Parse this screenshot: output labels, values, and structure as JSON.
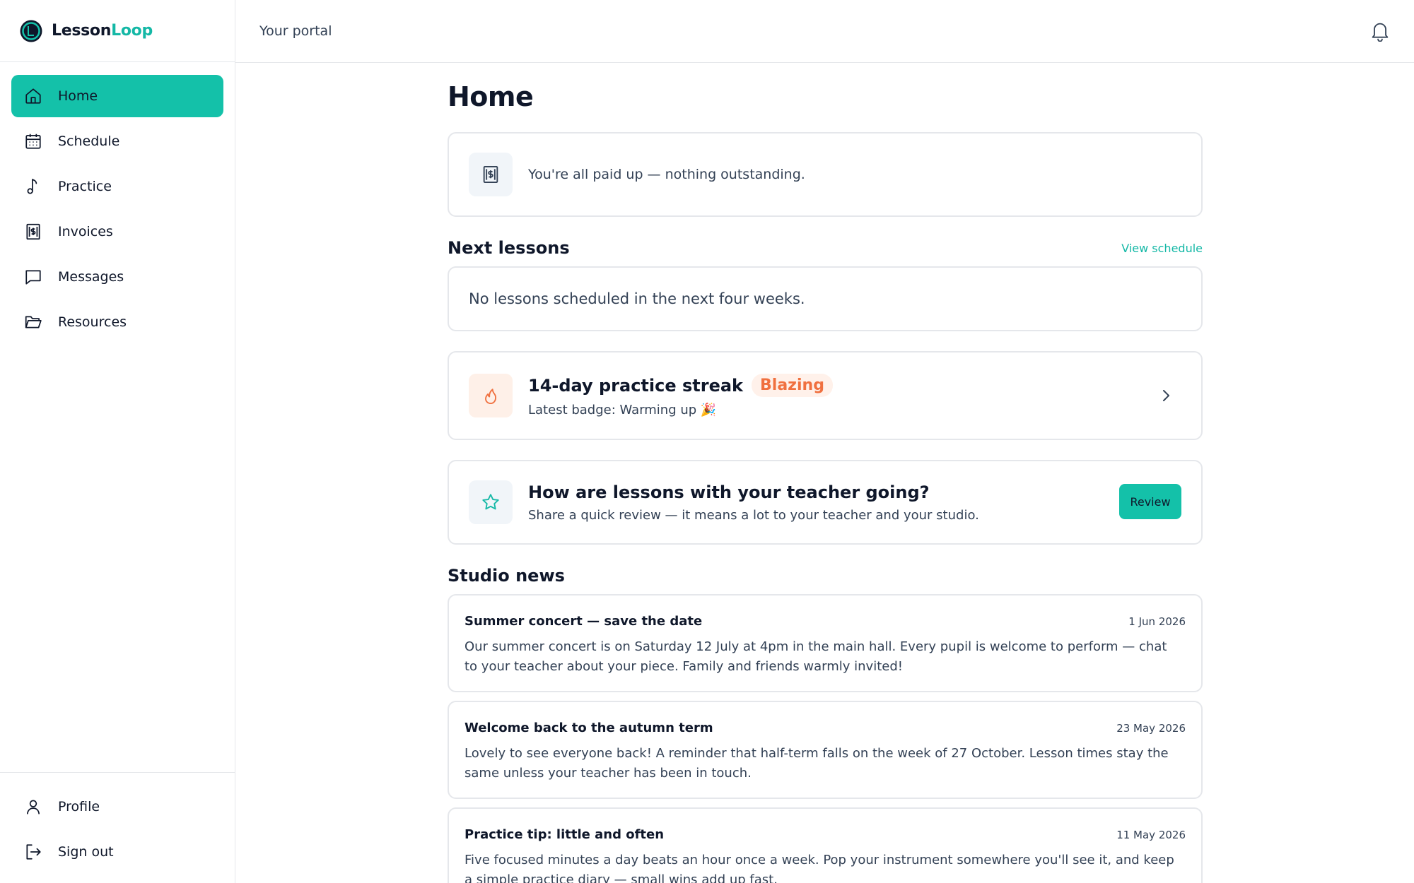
{
  "brand": {
    "name_part1": "Lesson",
    "name_part2": "Loop",
    "accent": "#14c1a9"
  },
  "sidebar": {
    "items": [
      {
        "label": "Home",
        "icon": "home-icon",
        "active": true
      },
      {
        "label": "Schedule",
        "icon": "calendar-icon",
        "active": false
      },
      {
        "label": "Practice",
        "icon": "music-note-icon",
        "active": false
      },
      {
        "label": "Invoices",
        "icon": "invoice-icon",
        "active": false
      },
      {
        "label": "Messages",
        "icon": "message-icon",
        "active": false
      },
      {
        "label": "Resources",
        "icon": "folder-icon",
        "active": false
      }
    ],
    "bottom_items": [
      {
        "label": "Profile",
        "icon": "user-icon"
      },
      {
        "label": "Sign out",
        "icon": "sign-out-icon"
      }
    ]
  },
  "topbar": {
    "title": "Your portal",
    "notifications_icon": "bell-icon"
  },
  "main": {
    "title": "Home",
    "payment_status": "You're all paid up — nothing outstanding.",
    "next_lessons": {
      "title": "Next lessons",
      "link": "View schedule",
      "empty_text": "No lessons scheduled in the next four weeks."
    },
    "streak": {
      "title": "14-day practice streak",
      "badge": "Blazing",
      "subtitle": "Latest badge: Warming up 🎉"
    },
    "review": {
      "title": "How are lessons with your teacher going?",
      "subtitle": "Share a quick review — it means a lot to your teacher and your studio.",
      "button": "Review"
    },
    "news": {
      "title": "Studio news",
      "items": [
        {
          "title": "Summer concert — save the date",
          "date": "1 Jun 2026",
          "body": "Our summer concert is on Saturday 12 July at 4pm in the main hall. Every pupil is welcome to perform — chat to your teacher about your piece. Family and friends warmly invited!"
        },
        {
          "title": "Welcome back to the autumn term",
          "date": "23 May 2026",
          "body": "Lovely to see everyone back! A reminder that half-term falls on the week of 27 October. Lesson times stay the same unless your teacher has been in touch."
        },
        {
          "title": "Practice tip: little and often",
          "date": "11 May 2026",
          "body": "Five focused minutes a day beats an hour once a week. Pop your instrument somewhere you'll see it, and keep a simple practice diary — small wins add up fast."
        }
      ]
    }
  }
}
